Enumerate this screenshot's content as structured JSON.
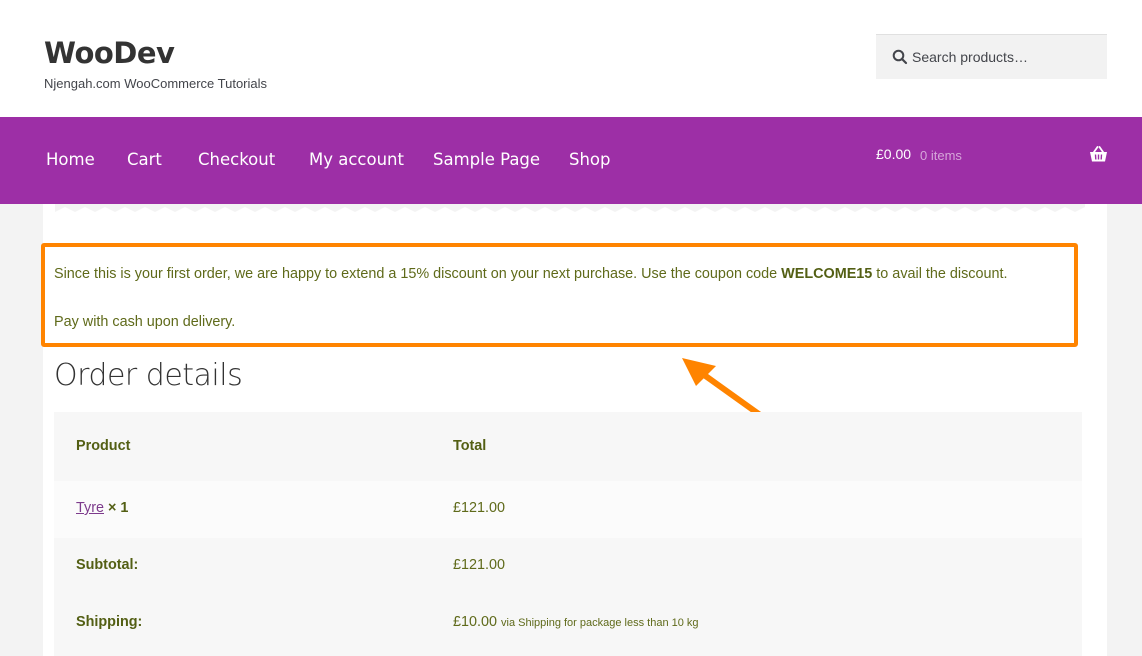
{
  "header": {
    "site_title": "WooDev",
    "site_description": "Njengah.com WooCommerce Tutorials",
    "search_placeholder": "Search products…"
  },
  "nav": {
    "items": [
      "Home",
      "Cart",
      "Checkout",
      "My account",
      "Sample Page",
      "Shop"
    ],
    "cart_amount": "£0.00",
    "cart_count": "0 items"
  },
  "notice": {
    "line1_before": "Since this is your first order, we are happy to extend a 15% discount on your next purchase. Use the coupon code ",
    "coupon_code": "WELCOME15",
    "line1_after": " to avail the discount.",
    "line2": "Pay with cash upon delivery."
  },
  "order": {
    "title": "Order details",
    "columns": [
      "Product",
      "Total"
    ],
    "rows": [
      {
        "product": "Tyre",
        "qty": "× 1",
        "total": "£121.00"
      },
      {
        "label": "Subtotal:",
        "value": "£121.00"
      },
      {
        "label": "Shipping:",
        "value": "£10.00",
        "note": "via Shipping for package less than 10 kg"
      }
    ]
  },
  "colors": {
    "nav_bg": "#9d2fa6",
    "highlight_border": "#ff8400",
    "text_green": "#5f6a1a",
    "link_purple": "#7d3b8c"
  },
  "icons": {
    "search": "search-icon",
    "basket": "basket-icon",
    "annotation": "annotation-arrow-icon"
  }
}
